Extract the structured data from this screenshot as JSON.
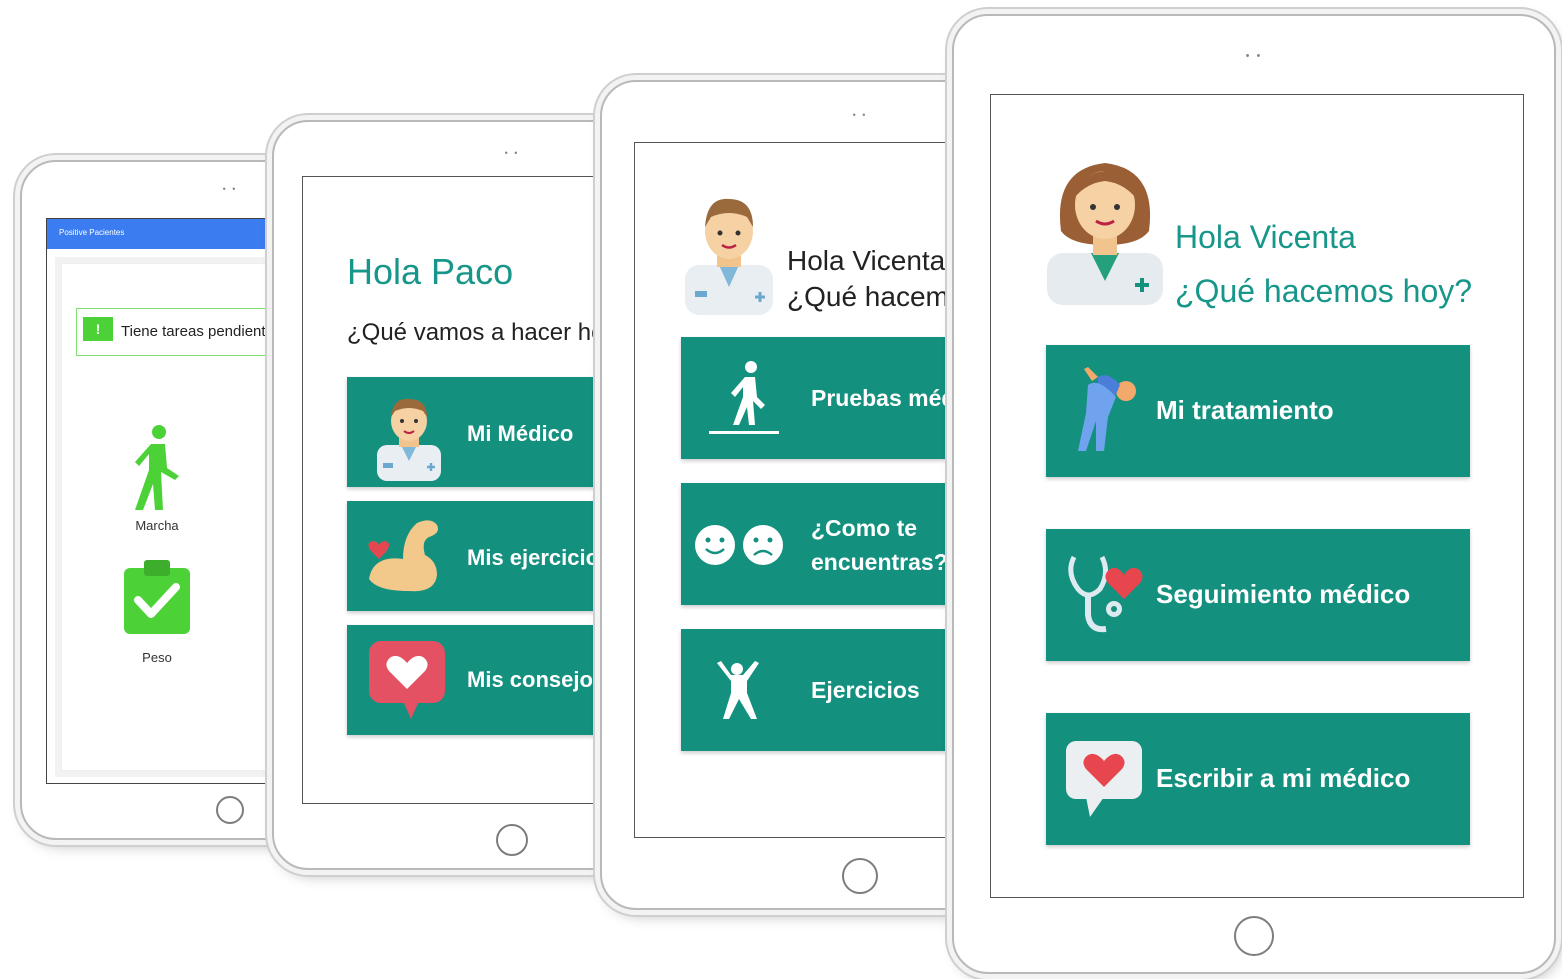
{
  "tablet1": {
    "app_title": "Positive Pacientes",
    "alert_text": "Tiene tareas pendientes",
    "alert_icon": "!",
    "items": [
      {
        "label": "Marcha",
        "icon": "walking-icon"
      },
      {
        "label": "Peso",
        "icon": "clipboard-check-icon"
      }
    ],
    "colors": {
      "appbar": "#3b7cf0",
      "accent": "#4cd137"
    }
  },
  "tablet2": {
    "greeting": "Hola Paco",
    "question": "¿Qué vamos a hacer hoy?",
    "buttons": [
      {
        "label": "Mi Médico",
        "icon": "doctor-icon"
      },
      {
        "label": "Mis ejercicios",
        "icon": "flexed-arm-icon"
      },
      {
        "label": "Mis consejos",
        "icon": "heart-message-icon"
      }
    ]
  },
  "tablet3": {
    "greeting": "Hola Vicenta",
    "question": "¿Qué hacemos hoy?",
    "buttons": [
      {
        "label": "Pruebas médicas",
        "icon": "walk-test-icon"
      },
      {
        "label": "¿Como te encuentras?",
        "icon": "faces-icon"
      },
      {
        "label": "Ejercicios",
        "icon": "exercise-icon"
      }
    ]
  },
  "tablet4": {
    "greeting": "Hola Vicenta",
    "question": "¿Qué hacemos hoy?",
    "buttons": [
      {
        "label": "Mi tratamiento",
        "icon": "stretching-icon"
      },
      {
        "label": "Seguimiento médico",
        "icon": "stethoscope-heart-icon"
      },
      {
        "label": "Escribir a mi médico",
        "icon": "heart-message-icon"
      }
    ]
  },
  "colors": {
    "teal": "#14907f",
    "greeting": "#17968a"
  }
}
